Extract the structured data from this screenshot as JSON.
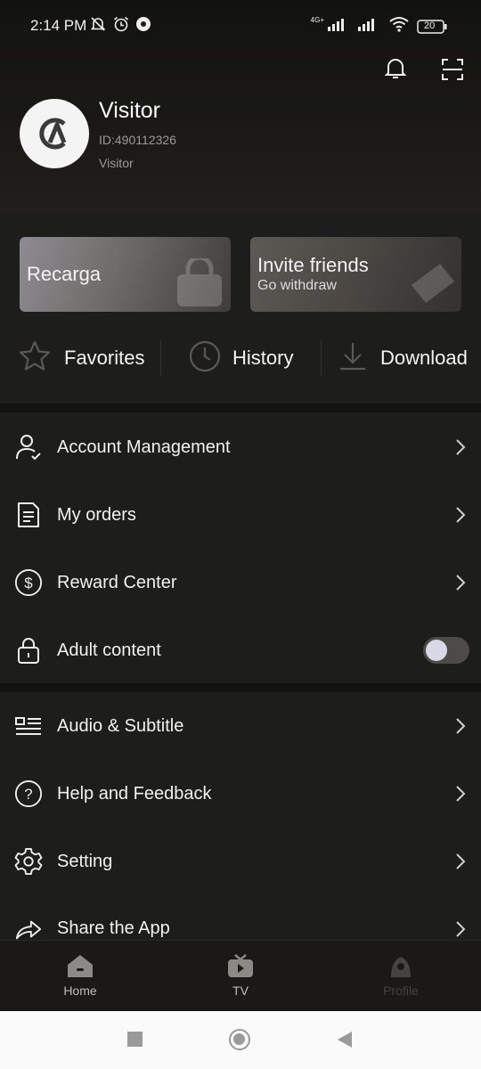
{
  "status_bar": {
    "time": "2:14 PM",
    "network": "4G+",
    "battery": "20"
  },
  "profile": {
    "name": "Visitor",
    "id": "ID:490112326",
    "type": "Visitor"
  },
  "cards": {
    "recarga": {
      "title": "Recarga"
    },
    "invite": {
      "title": "Invite friends",
      "subtitle": "Go withdraw"
    }
  },
  "quick_actions": [
    {
      "label": "Favorites",
      "icon": "star-icon"
    },
    {
      "label": "History",
      "icon": "clock-icon"
    },
    {
      "label": "Download",
      "icon": "download-icon"
    }
  ],
  "menu_group1": [
    {
      "label": "Account Management",
      "icon": "user-check-icon"
    },
    {
      "label": "My orders",
      "icon": "document-icon"
    },
    {
      "label": "Reward Center",
      "icon": "dollar-icon"
    },
    {
      "label": "Adult content",
      "icon": "lock-icon",
      "toggle_on": false
    }
  ],
  "menu_group2": [
    {
      "label": "Audio & Subtitle",
      "icon": "subtitle-icon"
    },
    {
      "label": "Help and Feedback",
      "icon": "question-icon"
    },
    {
      "label": "Setting",
      "icon": "gear-icon"
    },
    {
      "label": "Share the App",
      "icon": "share-icon"
    }
  ],
  "tabs": [
    {
      "label": "Home",
      "icon": "home-icon",
      "active": false
    },
    {
      "label": "TV",
      "icon": "tv-icon",
      "active": false
    },
    {
      "label": "Profile",
      "icon": "profile-icon",
      "active": true
    }
  ],
  "colors": {
    "background": "#1d1d1b",
    "divider": "#121210",
    "text": "#f1f1f1",
    "muted": "#9a9a96",
    "active_tab": "#45433f"
  }
}
